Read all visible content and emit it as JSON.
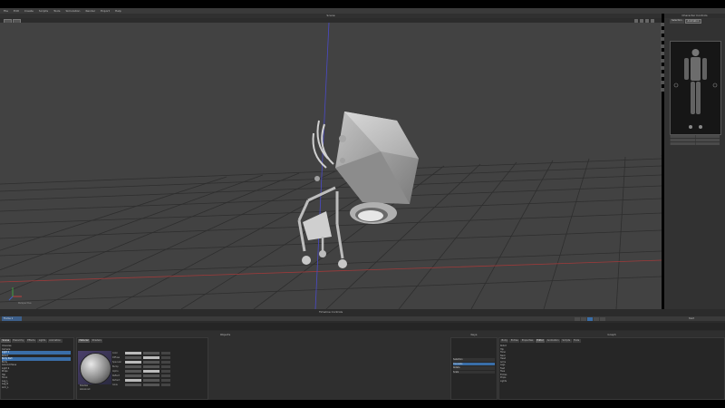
{
  "app": {
    "menu": [
      "File",
      "Edit",
      "Create",
      "Scripts",
      "Tools",
      "Simulation",
      "Render",
      "Export",
      "Help"
    ],
    "viewport_title": "Scene",
    "viewport_label": "Perspective",
    "right_panel_title": "Character Controls",
    "right_panel_tabs": [
      "Selection",
      "Animation"
    ]
  },
  "timeline": {
    "title": "Timeline Controls",
    "frame_label": "Frame 1",
    "range_label": "Start"
  },
  "bottom": {
    "scene_title": "Objects",
    "scene_tabs": [
      "Scene",
      "Hierarchy",
      "Effects",
      "Lights",
      "Animation"
    ],
    "scene_items": [
      "Universe",
      "Camera",
      "Light 1",
      "Robot",
      "Body Part",
      "Body",
      "Ground Plane",
      "Light 2",
      "Props",
      "Hip",
      "Torso",
      "Leg_L",
      "Leg_R",
      "Arm_L"
    ],
    "material_tabs": [
      "Material",
      "Shaders"
    ],
    "param_labels": [
      "Color",
      "Diffuse",
      "Specular",
      "Bump",
      "Alpha",
      "Reflect",
      "Refract",
      "Glow"
    ],
    "check_labels": [
      "Shadow",
      "Advanced"
    ],
    "keys_title": "Keys",
    "keys_items": [
      "Selection",
      "Translate",
      "Rotate",
      "Scale"
    ],
    "graph_title": "Graph",
    "graph_tabs": [
      "Body",
      "Extras",
      "Properties",
      "Editor",
      "Animation",
      "Scripts",
      "Tools"
    ],
    "tree_items": [
      "Robot",
      "Hip",
      "Torso",
      "Neck",
      "Head",
      "Arms",
      "Legs",
      "Feet",
      "Toes",
      "Extras",
      "Props",
      "Lights"
    ]
  },
  "colors": {
    "viewport_bg": "#434343",
    "grid": "#2e2e2e",
    "accent": "#3a6ea8",
    "axis_red": "#a03a3a",
    "axis_blue": "#4a4ac8"
  }
}
